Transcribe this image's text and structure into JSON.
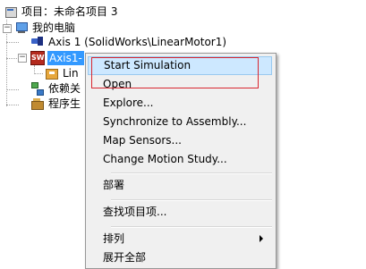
{
  "tree": {
    "project": "项目：未命名项目 3",
    "computer": "我的电脑",
    "axis1": "Axis 1 (SolidWorks\\LinearMotor1)",
    "axis1_selected": "Axis1-",
    "link": "Lin",
    "dependencies": "依赖关",
    "programs": "程序生",
    "sw_badge": "SW"
  },
  "menu": {
    "items": [
      "Start Simulation",
      "Open",
      "Explore...",
      "Synchronize to Assembly...",
      "Map Sensors...",
      "Change Motion Study...",
      "部署",
      "查找项目项...",
      "排列",
      "展开全部"
    ]
  },
  "colors": {
    "selection": "#3399ff",
    "menu_hover": "#cde8ff",
    "annotation": "#d9262f"
  }
}
